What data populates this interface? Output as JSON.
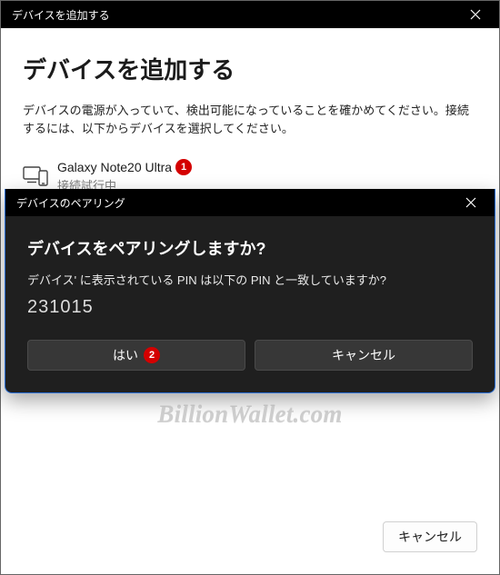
{
  "window": {
    "title": "デバイスを追加する"
  },
  "main": {
    "heading": "デバイスを追加する",
    "description": "デバイスの電源が入っていて、検出可能になっていることを確かめてください。接続するには、以下からデバイスを選択してください。",
    "device": {
      "name": "Galaxy Note20 Ultra",
      "status": "接続試行中",
      "badge": "1"
    }
  },
  "pair": {
    "title": "デバイスのペアリング",
    "heading": "デバイスをペアリングしますか?",
    "prompt": "デバイス' に表示されている PIN は以下の PIN と一致していますか?",
    "pin": "231015",
    "yes": "はい",
    "yes_badge": "2",
    "cancel": "キャンセル"
  },
  "footer": {
    "cancel": "キャンセル"
  },
  "watermark": "BillionWallet.com"
}
